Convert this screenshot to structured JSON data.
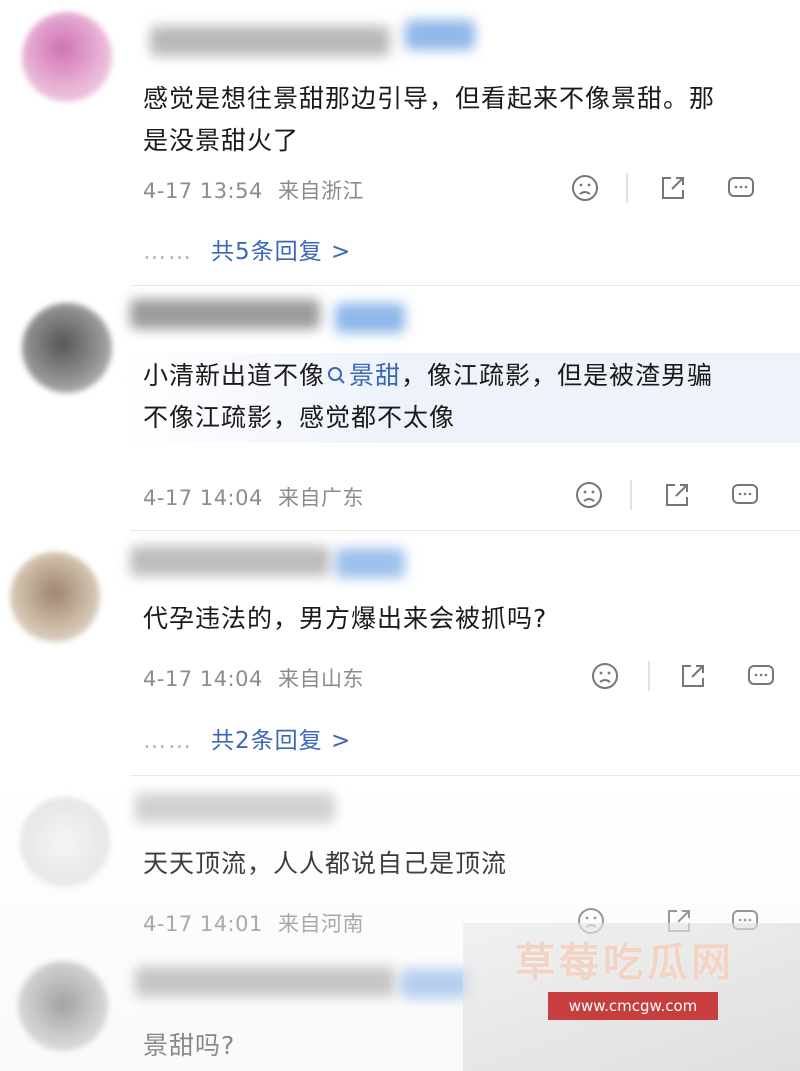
{
  "comments": [
    {
      "text_lines": [
        "感觉是想往景甜那边引导，但看起来不像景甜。那",
        "是没景甜火了"
      ],
      "time": "4-17 13:54",
      "location": "来自浙江",
      "replies": "共5条回复 >"
    },
    {
      "text_lines_pre": "小清新出道不像",
      "search_tag": "景甜",
      "text_lines_post": "，像江疏影，但是被渣男骗",
      "text_line2": "不像江疏影，感觉都不太像",
      "time": "4-17 14:04",
      "location": "来自广东"
    },
    {
      "text_lines": [
        "代孕违法的，男方爆出来会被抓吗?"
      ],
      "time": "4-17 14:04",
      "location": "来自山东",
      "replies": "共2条回复 >"
    },
    {
      "text_lines": [
        "天天顶流，人人都说自己是顶流"
      ],
      "time": "4-17 14:01",
      "location": "来自河南"
    },
    {
      "text_lines": [
        "景甜吗?"
      ]
    }
  ],
  "reply_dots": "……",
  "watermark": {
    "title": "草莓吃瓜网",
    "url": "www.cmcgw.com"
  },
  "icons": [
    "sad-face-icon",
    "share-icon",
    "comment-icon"
  ],
  "colors": {
    "link": "#3b67b8",
    "meta": "#8c8c8c",
    "watermark_red": "#c63e3e"
  }
}
